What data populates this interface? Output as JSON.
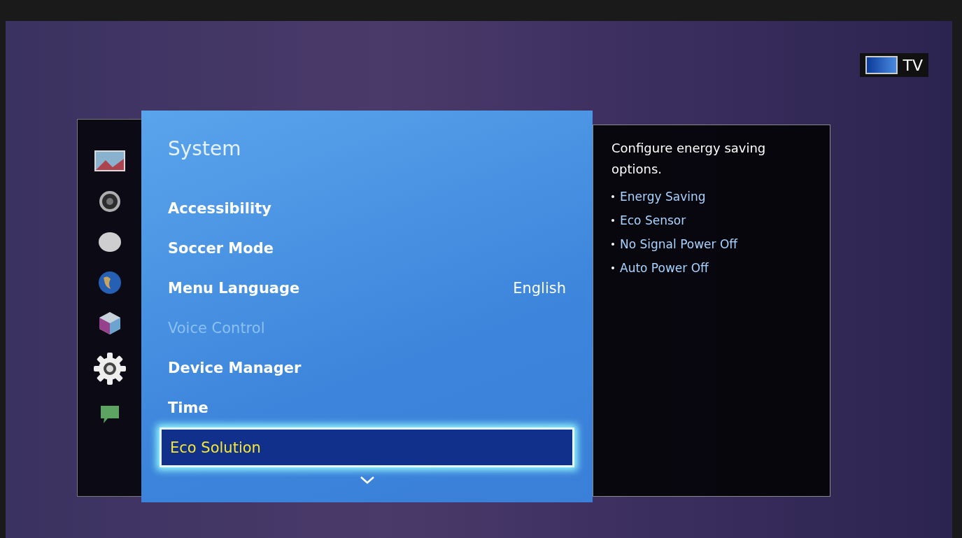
{
  "source_badge": {
    "label": "TV"
  },
  "sidebar": {
    "items": [
      {
        "kind": "picture",
        "selected": false
      },
      {
        "kind": "sound",
        "selected": false
      },
      {
        "kind": "broadcast",
        "selected": false
      },
      {
        "kind": "network",
        "selected": false
      },
      {
        "kind": "smart",
        "selected": false
      },
      {
        "kind": "system",
        "selected": true
      },
      {
        "kind": "support",
        "selected": false
      }
    ]
  },
  "menu": {
    "title": "System",
    "items": [
      {
        "label": "Accessibility",
        "disabled": false,
        "selected": false
      },
      {
        "label": "Soccer Mode",
        "disabled": false,
        "selected": false
      },
      {
        "label": "Menu Language",
        "value": "English",
        "disabled": false,
        "selected": false
      },
      {
        "label": "Voice Control",
        "disabled": true,
        "selected": false
      },
      {
        "label": "Device Manager",
        "disabled": false,
        "selected": false
      },
      {
        "label": "Time",
        "disabled": false,
        "selected": false
      },
      {
        "label": "Eco Solution",
        "disabled": false,
        "selected": true
      }
    ],
    "more_below": true
  },
  "info": {
    "description": "Configure energy saving options.",
    "options": [
      "Energy Saving",
      "Eco Sensor",
      "No Signal Power Off",
      "Auto Power Off"
    ]
  }
}
